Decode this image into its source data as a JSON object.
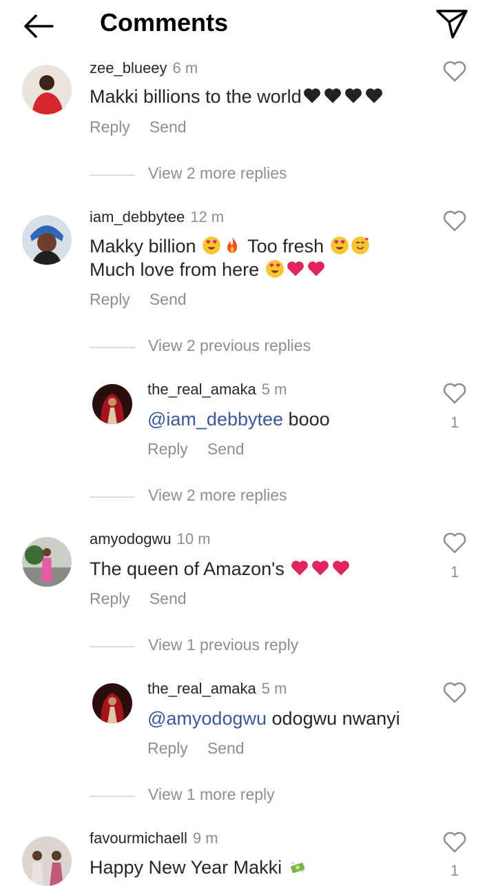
{
  "header": {
    "title": "Comments"
  },
  "actions": {
    "reply": "Reply",
    "send": "Send"
  },
  "comments": [
    {
      "username": "zee_blueey",
      "time": "6 m",
      "text": "Makki billions to the world",
      "emoji": [
        "black-heart",
        "black-heart",
        "black-heart",
        "black-heart"
      ]
    },
    {
      "username": "iam_debbytee",
      "time": "12 m",
      "line1": "Makky billion",
      "line1b": "Too fresh",
      "line2": "Much love from here"
    },
    {
      "username": "the_real_amaka",
      "time": "5 m",
      "mention": "@iam_debbytee",
      "text": "booo",
      "likes": "1"
    },
    {
      "username": "amyodogwu",
      "time": "10 m",
      "text": "The queen of Amazon's",
      "likes": "1"
    },
    {
      "username": "the_real_amaka",
      "time": "5 m",
      "mention": "@amyodogwu",
      "text": "odogwu nwanyi"
    },
    {
      "username": "favourmichaell",
      "time": "9 m",
      "text": "Happy New Year Makki",
      "likes": "1"
    }
  ],
  "threads": {
    "t1": "View 2 more replies",
    "t2": "View 2 previous replies",
    "t3": "View 2 more replies",
    "t4": "View 1 previous reply",
    "t5": "View 1 more reply"
  },
  "colors": {
    "text": "#262626",
    "secondary": "#8e8e8e",
    "mention": "#385898",
    "heart": "#e0245e"
  }
}
